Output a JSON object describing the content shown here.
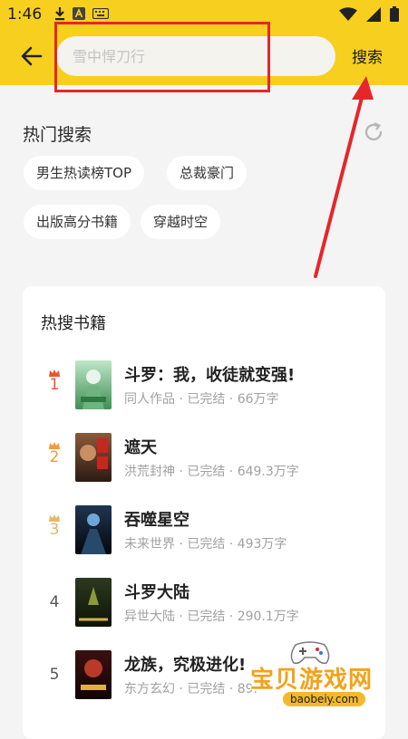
{
  "status_bar": {
    "time": "1:46"
  },
  "search": {
    "placeholder": "雪中悍刀行",
    "button_label": "搜索"
  },
  "hot_search": {
    "title": "热门搜索",
    "tags": [
      "男生热读榜TOP",
      "总裁豪门",
      "出版高分书籍",
      "穿越时空"
    ]
  },
  "hot_books": {
    "title": "热搜书籍",
    "items": [
      {
        "rank": "1",
        "title": "斗罗：我，收徒就变强!",
        "meta": "同人作品 · 已完结 · 66万字",
        "rank_color": "#e8552f"
      },
      {
        "rank": "2",
        "title": "遮天",
        "meta": "洪荒封神 · 已完结 · 649.3万字",
        "rank_color": "#f29a3f"
      },
      {
        "rank": "3",
        "title": "吞噬星空",
        "meta": "未来世界 · 已完结 · 493万字",
        "rank_color": "#e8b66a"
      },
      {
        "rank": "4",
        "title": "斗罗大陆",
        "meta": "异世大陆 · 已完结 · 290.1万字",
        "rank_color": "#555555"
      },
      {
        "rank": "5",
        "title": "龙族，究极进化!",
        "meta": "东方玄幻 · 已完结 · 89.",
        "rank_color": "#555555"
      }
    ]
  },
  "watermark": {
    "text": "宝贝游戏网",
    "url": "baobeiy.com"
  },
  "colors": {
    "header_bg": "#f7cf1e",
    "annotation_red": "#e6262a"
  },
  "icons": [
    "download-icon",
    "a-badge-icon",
    "keyboard-icon",
    "wifi-icon",
    "signal-icon",
    "battery-icon",
    "back-arrow-icon",
    "refresh-icon",
    "crown-icon"
  ]
}
